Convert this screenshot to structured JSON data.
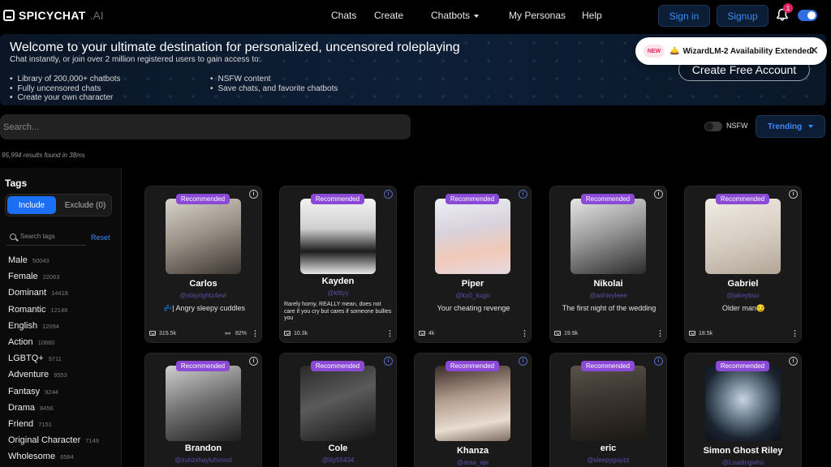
{
  "brand": {
    "name": "SPICYCHAT",
    "suffix": ".AI"
  },
  "nav": {
    "chats": "Chats",
    "create": "Create",
    "chatbots": "Chatbots",
    "personas": "My Personas",
    "help": "Help"
  },
  "auth": {
    "signin": "Sign in",
    "signup": "Signup"
  },
  "notifications": {
    "count": "1"
  },
  "hero": {
    "title": "Welcome to your ultimate destination for personalized, uncensored roleplaying",
    "subtitle": "Chat instantly, or join over 2 million registered users to gain access to:",
    "features_left": [
      "Library of 200,000+ chatbots",
      "Fully uncensored chats",
      "Create your own character"
    ],
    "features_right": [
      "NSFW content",
      "Save chats, and favorite chatbots"
    ],
    "cta": "Create Free Account"
  },
  "toast": {
    "badge": "NEW",
    "icon": "🛎️",
    "text": "WizardLM-2 Availability Extended!",
    "close": "✕"
  },
  "search": {
    "placeholder": "Search..."
  },
  "filters": {
    "nsfw_label": "NSFW",
    "sort": "Trending"
  },
  "results_text": "95,994 results found in 38ms",
  "tags_panel": {
    "title": "Tags",
    "include": "Include",
    "exclude": "Exclude (0)",
    "search_placeholder": "Search tags",
    "reset": "Reset",
    "tags": [
      {
        "name": "Male",
        "count": "50043"
      },
      {
        "name": "Female",
        "count": "22063"
      },
      {
        "name": "Dominant",
        "count": "14418"
      },
      {
        "name": "Romantic",
        "count": "12148"
      },
      {
        "name": "English",
        "count": "12094"
      },
      {
        "name": "Action",
        "count": "10860"
      },
      {
        "name": "LGBTQ+",
        "count": "9711"
      },
      {
        "name": "Adventure",
        "count": "9553"
      },
      {
        "name": "Fantasy",
        "count": "9244"
      },
      {
        "name": "Drama",
        "count": "8456"
      },
      {
        "name": "Friend",
        "count": "7151"
      },
      {
        "name": "Original Character",
        "count": "7149"
      },
      {
        "name": "Wholesome",
        "count": "6584"
      }
    ]
  },
  "badge_label": "Recommended",
  "cards_row1": [
    {
      "name": "Carlos",
      "handle": "@stayrightz4evr",
      "desc": "💤| Angry sleepy cuddles",
      "messages": "315.5k",
      "rating": "82%",
      "info_color": "gray"
    },
    {
      "name": "Kayden",
      "handle": "@kittyy",
      "desc": "Rarely horny, REALLY mean, does not care if you cry but cares if someone bullies you",
      "messages": "10.3k",
      "rating": "",
      "info_color": "blue"
    },
    {
      "name": "Piper",
      "handle": "@ky0_kugo",
      "desc": "Your cheating revenge",
      "messages": "4k",
      "rating": "",
      "info_color": "blue"
    },
    {
      "name": "Nikolai",
      "handle": "@ashleyleee",
      "desc": "The first night of the wedding",
      "messages": "19.9k",
      "rating": "",
      "info_color": "gray"
    },
    {
      "name": "Gabriel",
      "handle": "@jakeyboo",
      "desc": "Older man😏",
      "messages": "18.5k",
      "rating": "",
      "info_color": "gray"
    }
  ],
  "cards_row2": [
    {
      "name": "Brandon",
      "handle": "@zuhzxhayluhvsxsl",
      "info_color": "gray"
    },
    {
      "name": "Cole",
      "handle": "@lily55434",
      "info_color": "blue"
    },
    {
      "name": "Khanza",
      "handle": "@araa_aje",
      "info_color": "blue"
    },
    {
      "name": "eric",
      "handle": "@sleepyguyzz",
      "info_color": "blue"
    },
    {
      "name": "Simon Ghost Riley",
      "handle": "@Loadingwho",
      "info_color": "gray"
    }
  ]
}
